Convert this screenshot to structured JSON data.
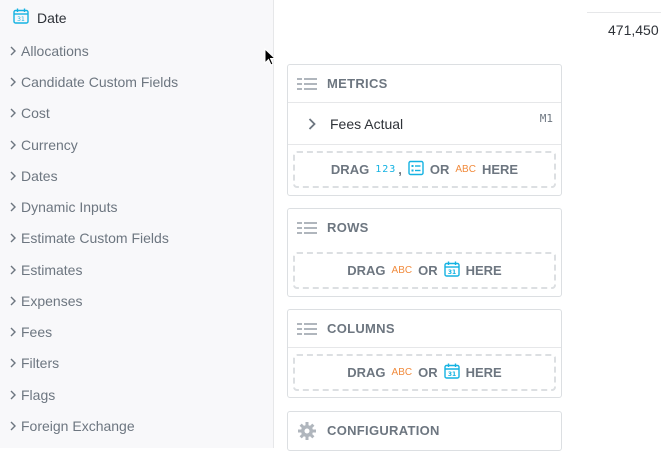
{
  "sidebar": {
    "date_label": "Date",
    "folders": [
      {
        "label": "Allocations"
      },
      {
        "label": "Candidate Custom Fields"
      },
      {
        "label": "Cost"
      },
      {
        "label": "Currency"
      },
      {
        "label": "Dates"
      },
      {
        "label": "Dynamic Inputs"
      },
      {
        "label": "Estimate Custom Fields"
      },
      {
        "label": "Estimates"
      },
      {
        "label": "Expenses"
      },
      {
        "label": "Fees"
      },
      {
        "label": "Filters"
      },
      {
        "label": "Flags"
      },
      {
        "label": "Foreign Exchange"
      }
    ]
  },
  "preview": {
    "value": "471,450"
  },
  "metrics": {
    "title": "METRICS",
    "item_label": "Fees Actual",
    "item_seq": "M1",
    "drag": "DRAG",
    "num_glyph": "123",
    "comma": ",",
    "or": "OR",
    "abc_glyph": "ABC",
    "here": "HERE"
  },
  "rows": {
    "title": "ROWS",
    "drag": "DRAG",
    "abc_glyph": "ABC",
    "or": "OR",
    "here": "HERE"
  },
  "columns": {
    "title": "COLUMNS",
    "drag": "DRAG",
    "abc_glyph": "ABC",
    "or": "OR",
    "here": "HERE"
  },
  "configuration": {
    "title": "CONFIGURATION"
  },
  "colors": {
    "accent_blue": "#14b2e2",
    "abc_orange": "#f18b3d",
    "muted": "#6d7680"
  }
}
